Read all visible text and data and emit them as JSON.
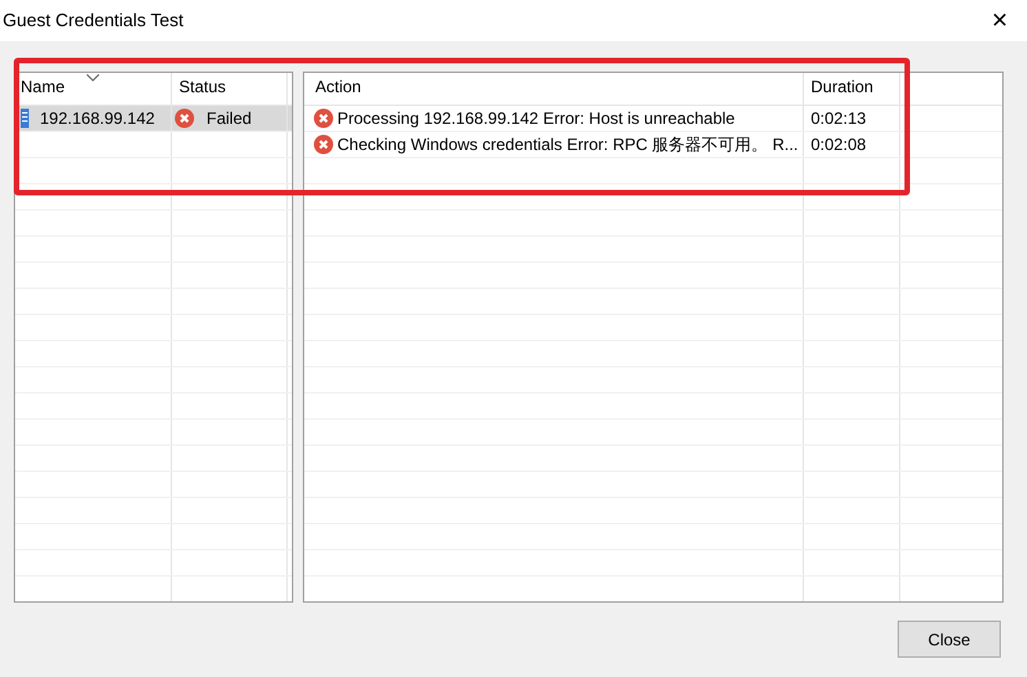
{
  "window": {
    "title": "Guest Credentials Test",
    "close_glyph": "×"
  },
  "hosts": {
    "columns": [
      "Name",
      "Status"
    ],
    "rows": [
      {
        "name": "192.168.99.142",
        "status": "Failed",
        "selected": true
      }
    ]
  },
  "actions": {
    "columns": [
      "Action",
      "Duration"
    ],
    "rows": [
      {
        "action": "Processing 192.168.99.142 Error: Host is unreachable",
        "duration": "0:02:13"
      },
      {
        "action": "Checking Windows credentials Error: RPC 服务器不可用。 R...",
        "duration": "0:02:08"
      }
    ]
  },
  "buttons": [
    "Close"
  ]
}
